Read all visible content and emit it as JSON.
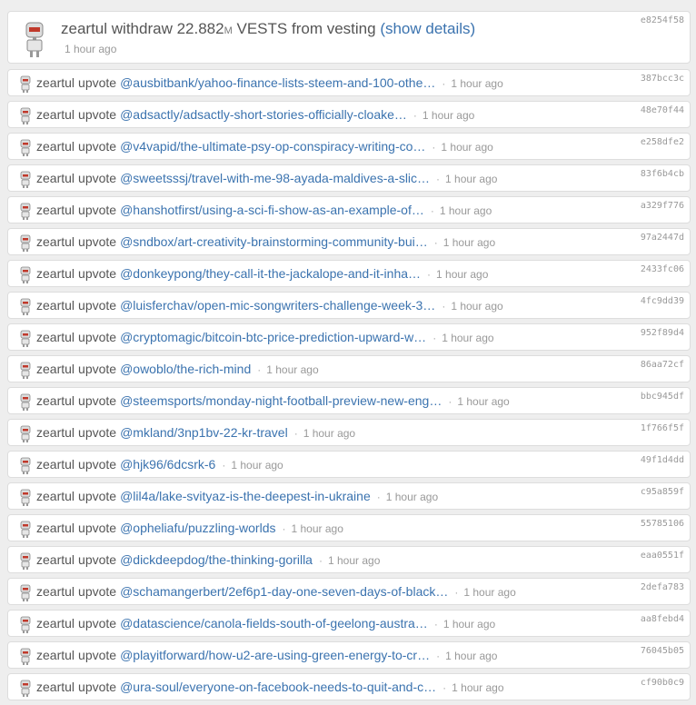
{
  "summary": {
    "user": "zeartul",
    "action": "withdraw",
    "amount": "22.882",
    "unit": "M",
    "asset": "VESTS",
    "suffix": "from vesting",
    "details_link": "(show details)",
    "time": "1 hour ago",
    "hash": "e8254f58"
  },
  "separator": "·",
  "votes": [
    {
      "user": "zeartul",
      "action": "upvote",
      "link": "@ausbitbank/yahoo-finance-lists-steem-and-100-othe…",
      "time": "1 hour ago",
      "hash": "387bcc3c"
    },
    {
      "user": "zeartul",
      "action": "upvote",
      "link": "@adsactly/adsactly-short-stories-officially-cloake…",
      "time": "1 hour ago",
      "hash": "48e70f44"
    },
    {
      "user": "zeartul",
      "action": "upvote",
      "link": "@v4vapid/the-ultimate-psy-op-conspiracy-writing-co…",
      "time": "1 hour ago",
      "hash": "e258dfe2"
    },
    {
      "user": "zeartul",
      "action": "upvote",
      "link": "@sweetsssj/travel-with-me-98-ayada-maldives-a-slic…",
      "time": "1 hour ago",
      "hash": "83f6b4cb"
    },
    {
      "user": "zeartul",
      "action": "upvote",
      "link": "@hanshotfirst/using-a-sci-fi-show-as-an-example-of…",
      "time": "1 hour ago",
      "hash": "a329f776"
    },
    {
      "user": "zeartul",
      "action": "upvote",
      "link": "@sndbox/art-creativity-brainstorming-community-bui…",
      "time": "1 hour ago",
      "hash": "97a2447d"
    },
    {
      "user": "zeartul",
      "action": "upvote",
      "link": "@donkeypong/they-call-it-the-jackalope-and-it-inha…",
      "time": "1 hour ago",
      "hash": "2433fc06"
    },
    {
      "user": "zeartul",
      "action": "upvote",
      "link": "@luisferchav/open-mic-songwriters-challenge-week-3…",
      "time": "1 hour ago",
      "hash": "4fc9dd39"
    },
    {
      "user": "zeartul",
      "action": "upvote",
      "link": "@cryptomagic/bitcoin-btc-price-prediction-upward-w…",
      "time": "1 hour ago",
      "hash": "952f89d4"
    },
    {
      "user": "zeartul",
      "action": "upvote",
      "link": "@owoblo/the-rich-mind",
      "time": "1 hour ago",
      "hash": "86aa72cf"
    },
    {
      "user": "zeartul",
      "action": "upvote",
      "link": "@steemsports/monday-night-football-preview-new-eng…",
      "time": "1 hour ago",
      "hash": "bbc945df"
    },
    {
      "user": "zeartul",
      "action": "upvote",
      "link": "@mkland/3np1bv-22-kr-travel",
      "time": "1 hour ago",
      "hash": "1f766f5f"
    },
    {
      "user": "zeartul",
      "action": "upvote",
      "link": "@hjk96/6dcsrk-6",
      "time": "1 hour ago",
      "hash": "49f1d4dd"
    },
    {
      "user": "zeartul",
      "action": "upvote",
      "link": "@lil4a/lake-svityaz-is-the-deepest-in-ukraine",
      "time": "1 hour ago",
      "hash": "c95a859f"
    },
    {
      "user": "zeartul",
      "action": "upvote",
      "link": "@opheliafu/puzzling-worlds",
      "time": "1 hour ago",
      "hash": "55785106"
    },
    {
      "user": "zeartul",
      "action": "upvote",
      "link": "@dickdeepdog/the-thinking-gorilla",
      "time": "1 hour ago",
      "hash": "eaa0551f"
    },
    {
      "user": "zeartul",
      "action": "upvote",
      "link": "@schamangerbert/2ef6p1-day-one-seven-days-of-black…",
      "time": "1 hour ago",
      "hash": "2defa783"
    },
    {
      "user": "zeartul",
      "action": "upvote",
      "link": "@datascience/canola-fields-south-of-geelong-austra…",
      "time": "1 hour ago",
      "hash": "aa8febd4"
    },
    {
      "user": "zeartul",
      "action": "upvote",
      "link": "@playitforward/how-u2-are-using-green-energy-to-cr…",
      "time": "1 hour ago",
      "hash": "76045b05"
    },
    {
      "user": "zeartul",
      "action": "upvote",
      "link": "@ura-soul/everyone-on-facebook-needs-to-quit-and-c…",
      "time": "1 hour ago",
      "hash": "cf90b0c9"
    }
  ]
}
